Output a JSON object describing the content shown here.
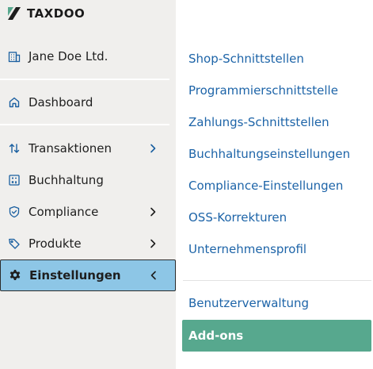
{
  "brand": {
    "name": "TAXDOO"
  },
  "company": {
    "name": "Jane Doe Ltd."
  },
  "sidebar": {
    "items": [
      {
        "label": "Dashboard"
      },
      {
        "label": "Transaktionen"
      },
      {
        "label": "Buchhaltung"
      },
      {
        "label": "Compliance"
      },
      {
        "label": "Produkte"
      },
      {
        "label": "Einstellungen"
      }
    ]
  },
  "settings_menu": {
    "items": [
      {
        "label": "Shop-Schnittstellen"
      },
      {
        "label": "Programmierschnittstelle"
      },
      {
        "label": "Zahlungs-Schnittstellen"
      },
      {
        "label": "Buchhaltungseinstellungen"
      },
      {
        "label": "Compliance-Einstellungen"
      },
      {
        "label": "OSS-Korrekturen"
      },
      {
        "label": "Unternehmensprofil"
      },
      {
        "label": "Benutzerverwaltung"
      },
      {
        "label": "Add-ons"
      }
    ]
  },
  "colors": {
    "sidebar_bg": "#f0efed",
    "active_nav_bg": "#8dc6e6",
    "link": "#1d64a8",
    "active_submenu_bg": "#57a88e"
  }
}
